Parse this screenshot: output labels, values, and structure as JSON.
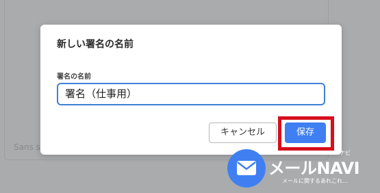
{
  "background": {
    "text": "Sans s"
  },
  "dialog": {
    "title": "新しい署名の名前",
    "field_label": "署名の名前",
    "field_value": "署名（仕事用）",
    "cancel_label": "キャンセル",
    "save_label": "保存"
  },
  "watermark": {
    "brand": "メールNAVI",
    "ruby": "ナビ",
    "tagline": "メールに関するあれこれ..."
  },
  "colors": {
    "accent": "#3f7ff2",
    "highlight": "#d60f1c",
    "input_border": "#3e7fd6",
    "overlay": "#a9abad"
  }
}
